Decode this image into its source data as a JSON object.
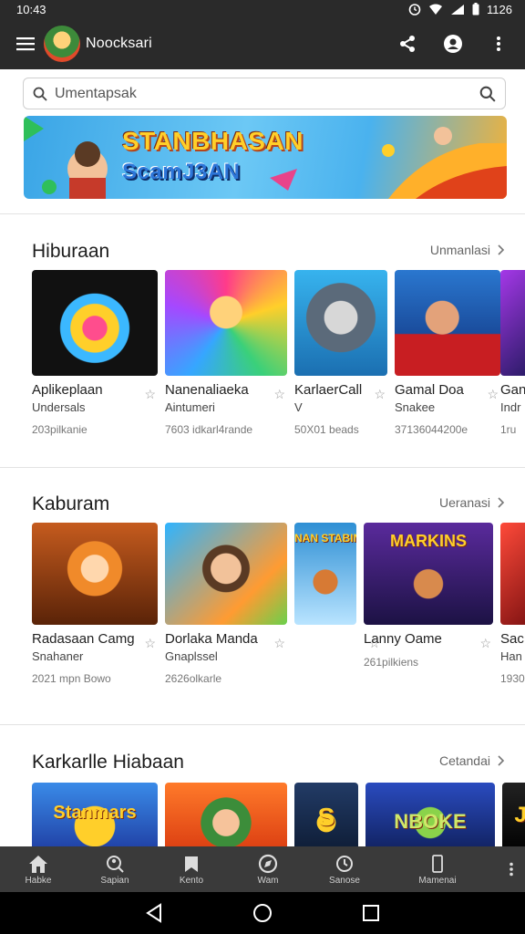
{
  "status_bar": {
    "time": "10:43",
    "battery": "1126"
  },
  "app_bar": {
    "title": "Noocksari"
  },
  "search": {
    "placeholder": "Umentapsak"
  },
  "banner": {
    "title": "STANBHASAN",
    "subtitle": "ScamJ3AN"
  },
  "sections": [
    {
      "title": "Hiburaan",
      "more": "Unmanlasi",
      "cards": [
        {
          "name": "Aplikeplaan",
          "sub": "Undersals",
          "meta": "203pilkanie"
        },
        {
          "name": "Nanenaliaeka",
          "sub": "Aintumeri",
          "meta": "7603 idkarl4rande"
        },
        {
          "name": "KarlaerCall",
          "sub": "V",
          "meta": "50X01 beads"
        },
        {
          "name": "Gamal Doa",
          "sub": "Snakee",
          "meta": "37136044200e"
        },
        {
          "name": "Gan",
          "sub": "Indr",
          "meta": "1ru"
        }
      ]
    },
    {
      "title": "Kaburam",
      "more": "Ueranasi",
      "cards": [
        {
          "name": "Radasaan Camg",
          "sub": "Snahaner",
          "meta": "2021 mpn Bowo",
          "tag": ""
        },
        {
          "name": "Dorlaka Manda",
          "sub": "Gnaplssel",
          "meta": "2626olkarle",
          "tag": ""
        },
        {
          "name": "",
          "sub": "",
          "meta": "",
          "tag": "NAN STABIN"
        },
        {
          "name": "Lanny Oame",
          "sub": "",
          "meta": "261pilkiens",
          "tag": "MARKINS"
        },
        {
          "name": "Sac",
          "sub": "Han",
          "meta": "1930"
        }
      ]
    },
    {
      "title": "Karkarlle Hiabaan",
      "more": "Cetandai",
      "cards": [
        {
          "tag": "Stanmars"
        },
        {
          "tag": ""
        },
        {
          "tag": "S"
        },
        {
          "tag": "NBOKE"
        },
        {
          "tag": "J"
        }
      ]
    }
  ],
  "bottom_nav": [
    {
      "label": "Habke",
      "icon": "home-icon"
    },
    {
      "label": "Sapian",
      "icon": "search-person-icon"
    },
    {
      "label": "Kento",
      "icon": "bookmark-icon"
    },
    {
      "label": "Wam",
      "icon": "compass-icon"
    },
    {
      "label": "Sanose",
      "icon": "clock-icon"
    },
    {
      "label": "Mamenai",
      "icon": "phone-icon"
    }
  ],
  "colors": {
    "bar": "#2a2a2a",
    "nav": "#3a3a3a",
    "banner_title": "#ffcf2a",
    "banner_sub": "#2d76d9"
  }
}
